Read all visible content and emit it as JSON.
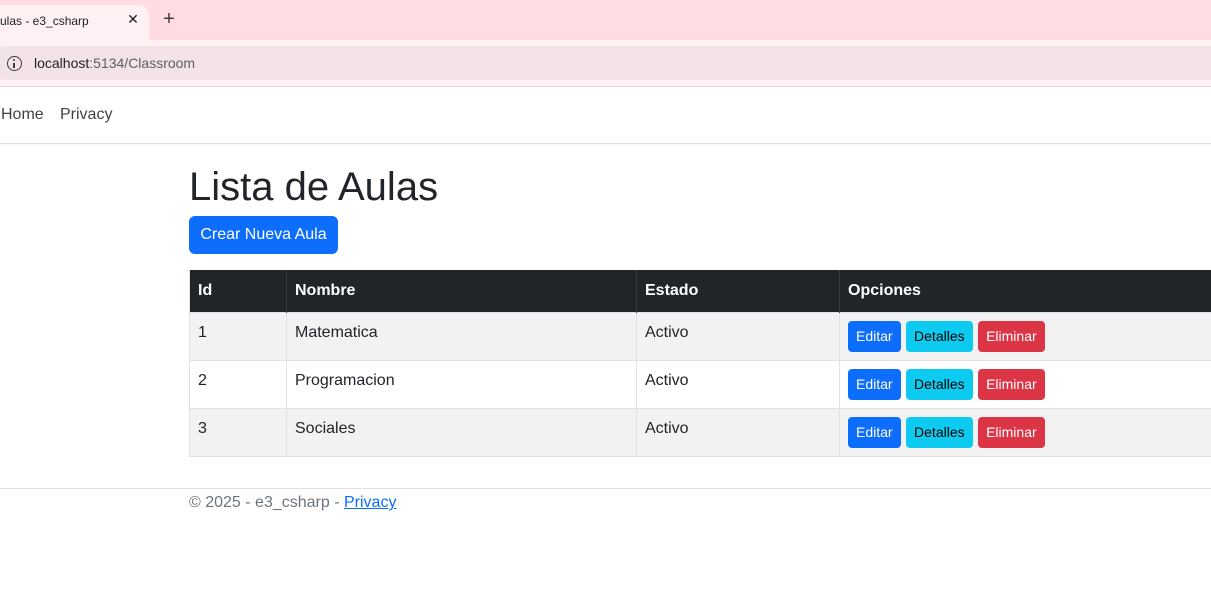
{
  "browser": {
    "tab_title": "ulas - e3_csharp",
    "tab_close": "✕",
    "new_tab": "+",
    "url_host": "localhost",
    "url_path": ":5134/Classroom"
  },
  "nav": {
    "home": "Home",
    "privacy": "Privacy"
  },
  "main": {
    "title": "Lista de Aulas",
    "create_button": "Crear Nueva Aula",
    "columns": [
      "Id",
      "Nombre",
      "Estado",
      "Opciones"
    ],
    "rows": [
      {
        "id": "1",
        "nombre": "Matematica",
        "estado": "Activo"
      },
      {
        "id": "2",
        "nombre": "Programacion",
        "estado": "Activo"
      },
      {
        "id": "3",
        "nombre": "Sociales",
        "estado": "Activo"
      }
    ],
    "actions": {
      "edit": "Editar",
      "details": "Detalles",
      "delete": "Eliminar"
    }
  },
  "footer": {
    "copyright": "© 2025 - e3_csharp - ",
    "privacy_link": "Privacy"
  },
  "colors": {
    "primary": "#0d6efd",
    "info": "#0dcaf0",
    "danger": "#dc3545",
    "table_header": "#212529"
  }
}
